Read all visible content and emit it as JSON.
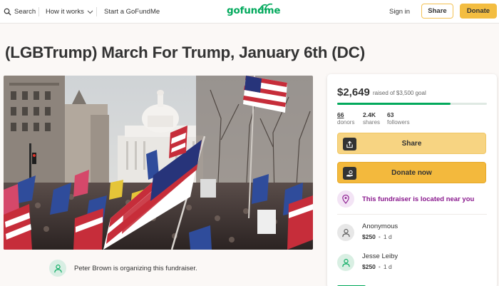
{
  "nav": {
    "search_label": "Search",
    "how_label": "How it works",
    "start_label": "Start a GoFundMe",
    "logo_text": "gofundme",
    "signin_label": "Sign in",
    "share_label": "Share",
    "donate_label": "Donate"
  },
  "campaign": {
    "title": "(LGBTrump) March For Trump, January 6th (DC)",
    "organizer_text": "Peter Brown is organizing this fundraiser."
  },
  "progress": {
    "raised": "$2,649",
    "goal_text": "raised of $3,500 goal",
    "fraction": 0.757
  },
  "stats": [
    {
      "value": "66",
      "label": "donors"
    },
    {
      "value": "2.4K",
      "label": "shares"
    },
    {
      "value": "63",
      "label": "followers"
    }
  ],
  "actions": {
    "share_label": "Share",
    "donate_label": "Donate now",
    "near_text": "This fundraiser is located near you"
  },
  "donations": [
    {
      "name": "Anonymous",
      "amount": "$250",
      "time": "1 d"
    },
    {
      "name": "Jesse Leiby",
      "amount": "$250",
      "time": "1 d"
    }
  ],
  "colors": {
    "brand_green": "#02a95c",
    "donate_yellow": "#f3b93d",
    "share_yellow": "#f7d482",
    "near_purple": "#8a1a8e"
  },
  "icons": {
    "search": "search-icon",
    "chevron": "chevron-down-icon",
    "share": "share-icon",
    "donate": "donate-icon",
    "location": "location-pin-icon",
    "user": "user-icon"
  }
}
